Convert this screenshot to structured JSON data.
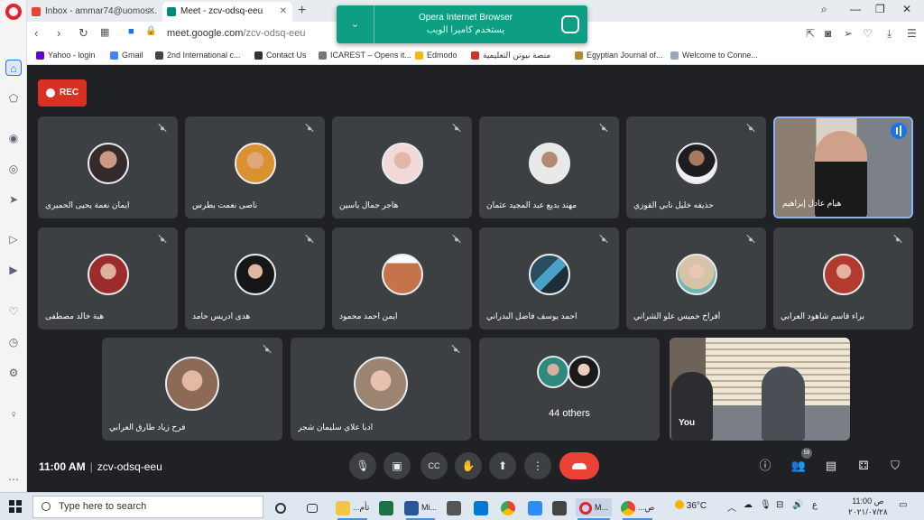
{
  "colors": {
    "accent": "#1a73e8",
    "end_call": "#ea4335",
    "record": "#d93025",
    "popup": "#0d9e84"
  },
  "browser": {
    "tabs": [
      {
        "label": "Inbox - ammar74@uomos...",
        "icon": "gmail-icon"
      },
      {
        "label": "Meet - zcv-odsq-eeu",
        "icon": "meet-icon"
      }
    ],
    "url_host": "meet.google.com",
    "url_path": "/zcv-odsq-eeu",
    "bookmarks": [
      "Yahoo - login",
      "Gmail",
      "2nd International c...",
      "Contact Us",
      "ICAREST – Opens it...",
      "Edmodo",
      "منصة نيوتن التعليمية",
      "Egyptian Journal of...",
      "Welcome to Conne..."
    ]
  },
  "popup": {
    "title": "Opera Internet Browser",
    "subtitle": "يستخدم كاميرا الويب"
  },
  "meet": {
    "rec_label": "REC",
    "row1": [
      "ايمان نعمة يحيى الحميري",
      "ناصى نعمت بطرس",
      "هاجر جمال ياسين",
      "مهند بديع عبد المجيد عثمان",
      "حذيفه خليل نابي القوزي",
      "هيام عادل إبراهيم"
    ],
    "row2": [
      "هبة خالد مصطفى",
      "هدى ادريس حامد",
      "ايمن احمد محمود",
      "احمد يوسف فاضل البدراني",
      "أفراح خميس علو الشراني",
      "براء قاسم شاهود العرابي"
    ],
    "row3": [
      "فرح زياد طارق العرابي",
      "ادبا علاي سليمان شجر"
    ],
    "others_label": "44 others",
    "you_label": "You",
    "time": "11:00 AM",
    "meeting_code": "zcv-odsq-eeu",
    "people_count": "59"
  },
  "taskbar": {
    "search_placeholder": "Type here to search",
    "items": [
      "...تأم",
      "Mi...",
      "...مي",
      "M...",
      "...ص"
    ],
    "temperature": "36°C",
    "lang": "ع",
    "time": "11:00 ص",
    "date": "٢٠٢١/٠٧/٢٨"
  }
}
